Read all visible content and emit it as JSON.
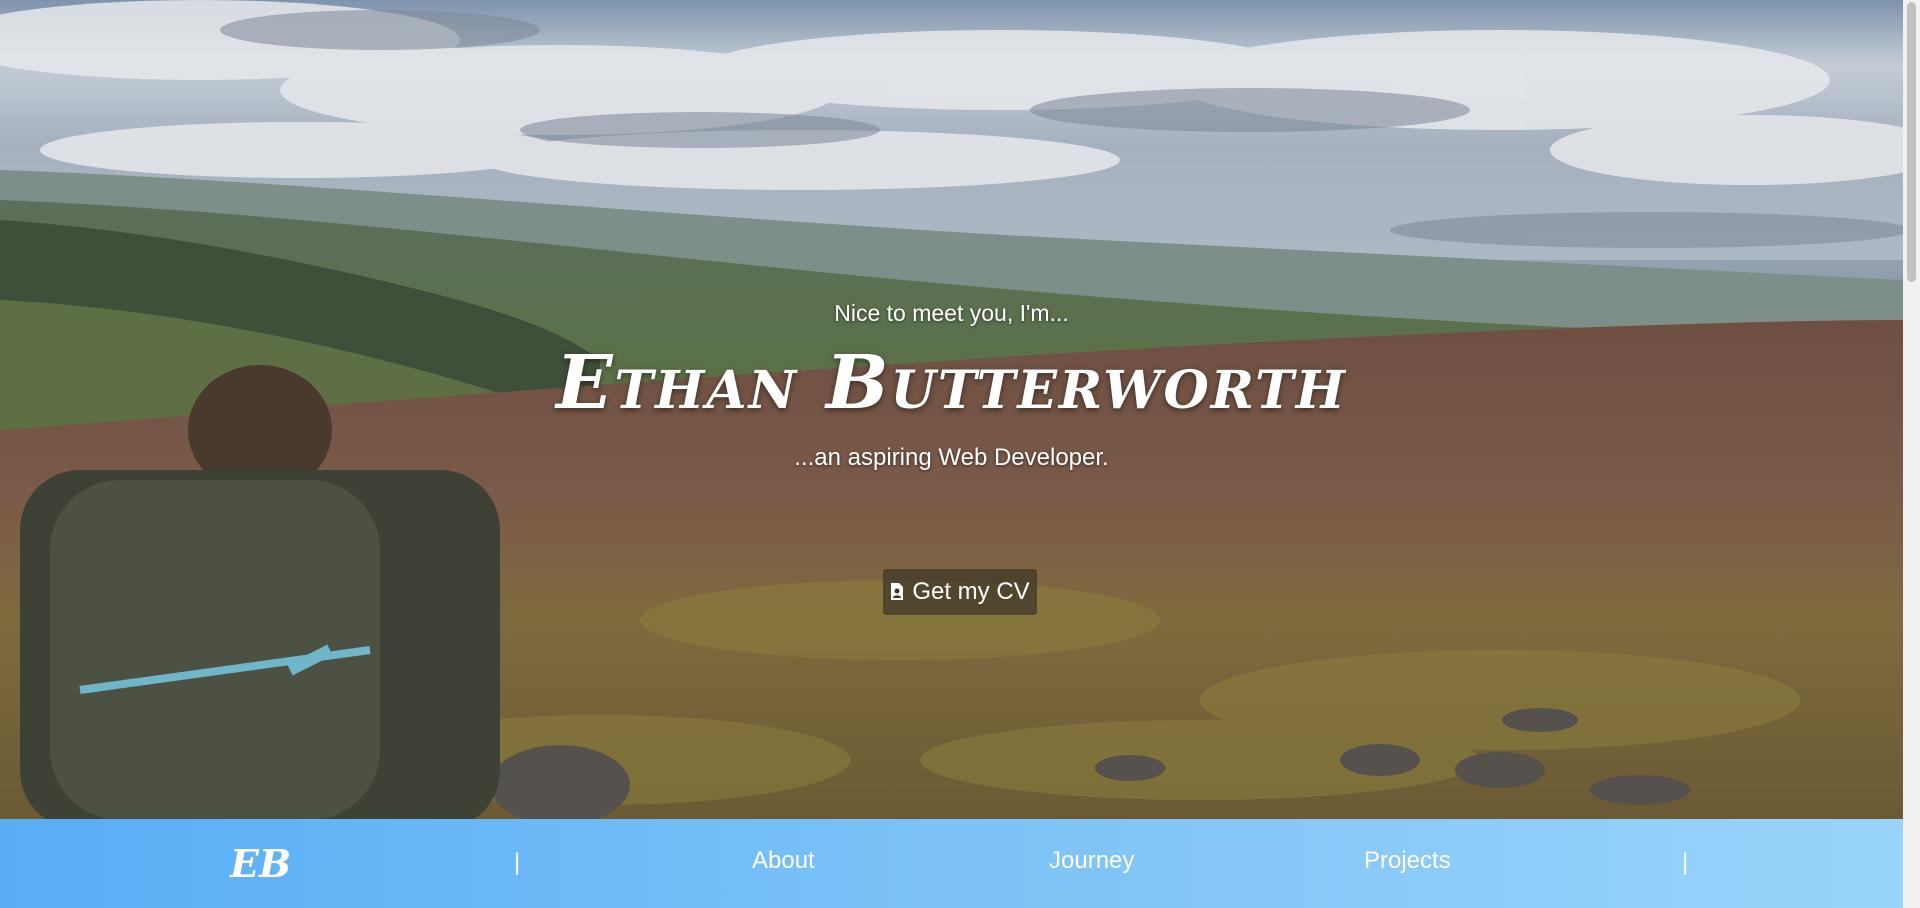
{
  "hero": {
    "greeting": "Nice to meet you, I'm...",
    "name": "Ethan Butterworth",
    "tagline": "...an aspiring Web Developer.",
    "cv_button": {
      "label": "Get my CV",
      "icon": "file-person-icon"
    }
  },
  "navbar": {
    "logo": "EB",
    "separator": "|",
    "links": [
      {
        "label": "About"
      },
      {
        "label": "Journey"
      },
      {
        "label": "Projects"
      }
    ]
  },
  "colors": {
    "nav_gradient_start": "#58adf5",
    "nav_gradient_end": "#9ad4fb",
    "hero_text": "#ffffff",
    "cv_button_bg": "#3c3428"
  }
}
